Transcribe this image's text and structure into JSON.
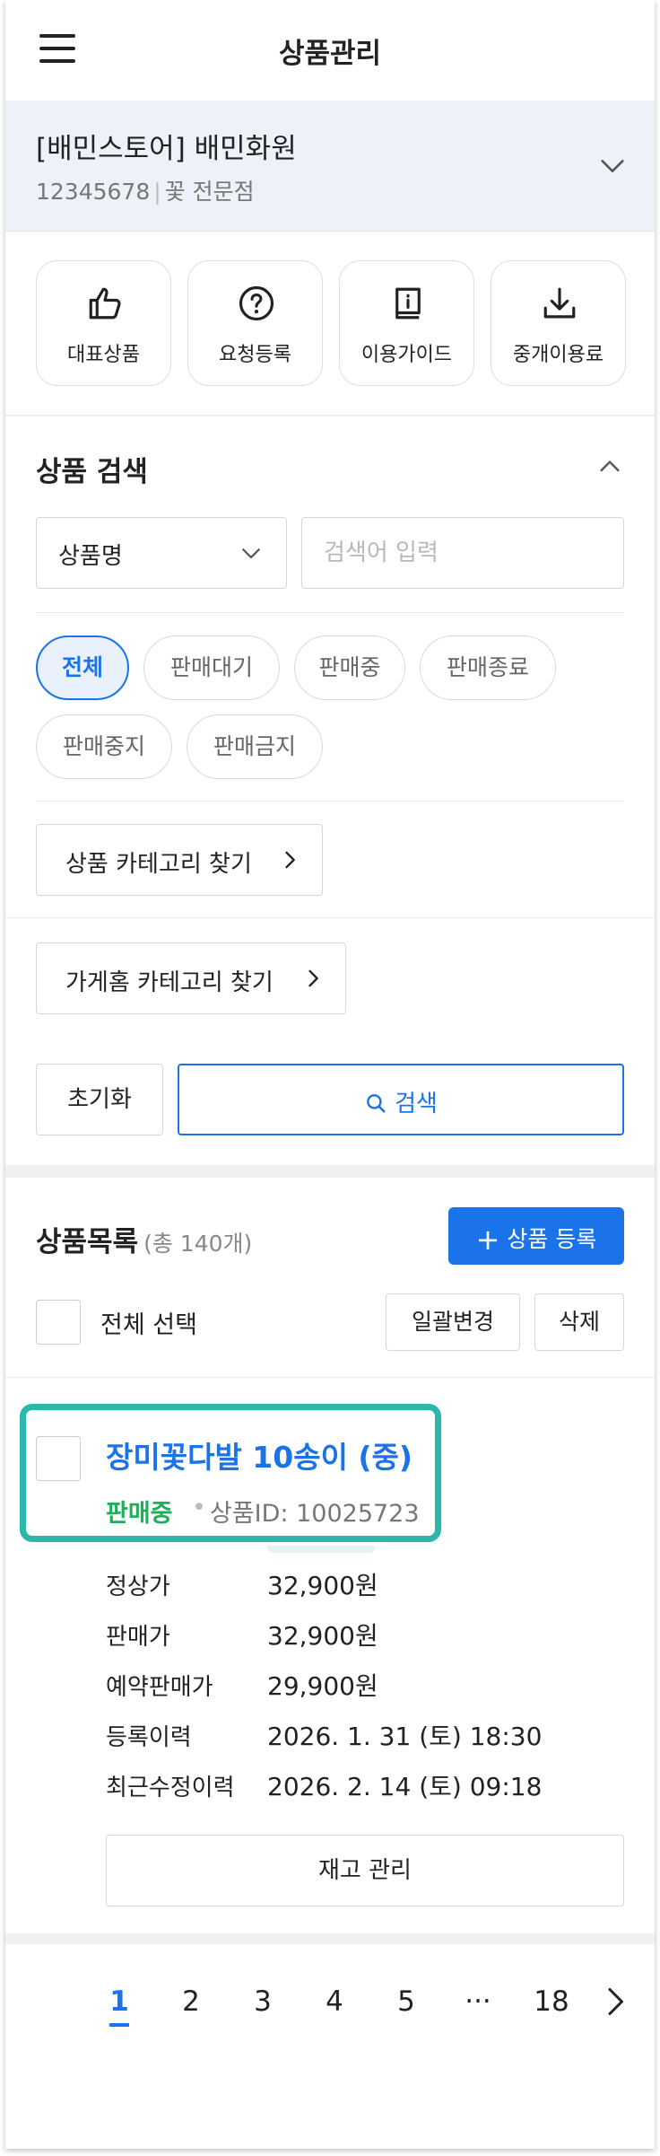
{
  "header": {
    "title": "상품관리"
  },
  "store": {
    "name": "[배민스토어] 배민화원",
    "id": "12345678",
    "sep": "|",
    "type": "꽃 전문점"
  },
  "quick_menu": [
    {
      "label": "대표상품",
      "icon": "thumbs-up-icon"
    },
    {
      "label": "요청등록",
      "icon": "question-circle-icon"
    },
    {
      "label": "이용가이드",
      "icon": "guide-book-icon"
    },
    {
      "label": "중개이용료",
      "icon": "download-icon"
    }
  ],
  "search": {
    "title": "상품 검색",
    "field_select": "상품명",
    "placeholder": "검색어 입력",
    "chips": [
      "전체",
      "판매대기",
      "판매중",
      "판매종료",
      "판매중지",
      "판매금지"
    ],
    "active_chip": "전체",
    "product_category_btn": "상품 카테고리 찾기",
    "store_category_btn": "가게홈 카테고리 찾기",
    "reset_btn": "초기화",
    "search_btn": "검색"
  },
  "list": {
    "title": "상품목록",
    "count": "(총 140개)",
    "register_btn": "상품 등록",
    "select_all": "전체 선택",
    "bulk_btn": "일괄변경",
    "delete_btn": "삭제"
  },
  "product": {
    "name": "장미꽃다발 10송이 (중)",
    "status": "판매중",
    "dot": "•",
    "id_text": "상품ID: 10025723",
    "details": [
      {
        "label": "정상가",
        "value": "32,900원"
      },
      {
        "label": "판매가",
        "value": "32,900원"
      },
      {
        "label": "예약판매가",
        "value": "29,900원"
      },
      {
        "label": "등록이력",
        "value": "2026. 1. 31 (토) 18:30"
      },
      {
        "label": "최근수정이력",
        "value": "2026. 2. 14 (토) 09:18"
      }
    ],
    "stock_btn": "재고 관리"
  },
  "pagination": {
    "pages": [
      "1",
      "2",
      "3",
      "4",
      "5",
      "···",
      "18"
    ],
    "current": "1"
  },
  "colors": {
    "accent": "#1a73e8",
    "status_green": "#1fae5a",
    "highlight": "#2bb7ac"
  }
}
